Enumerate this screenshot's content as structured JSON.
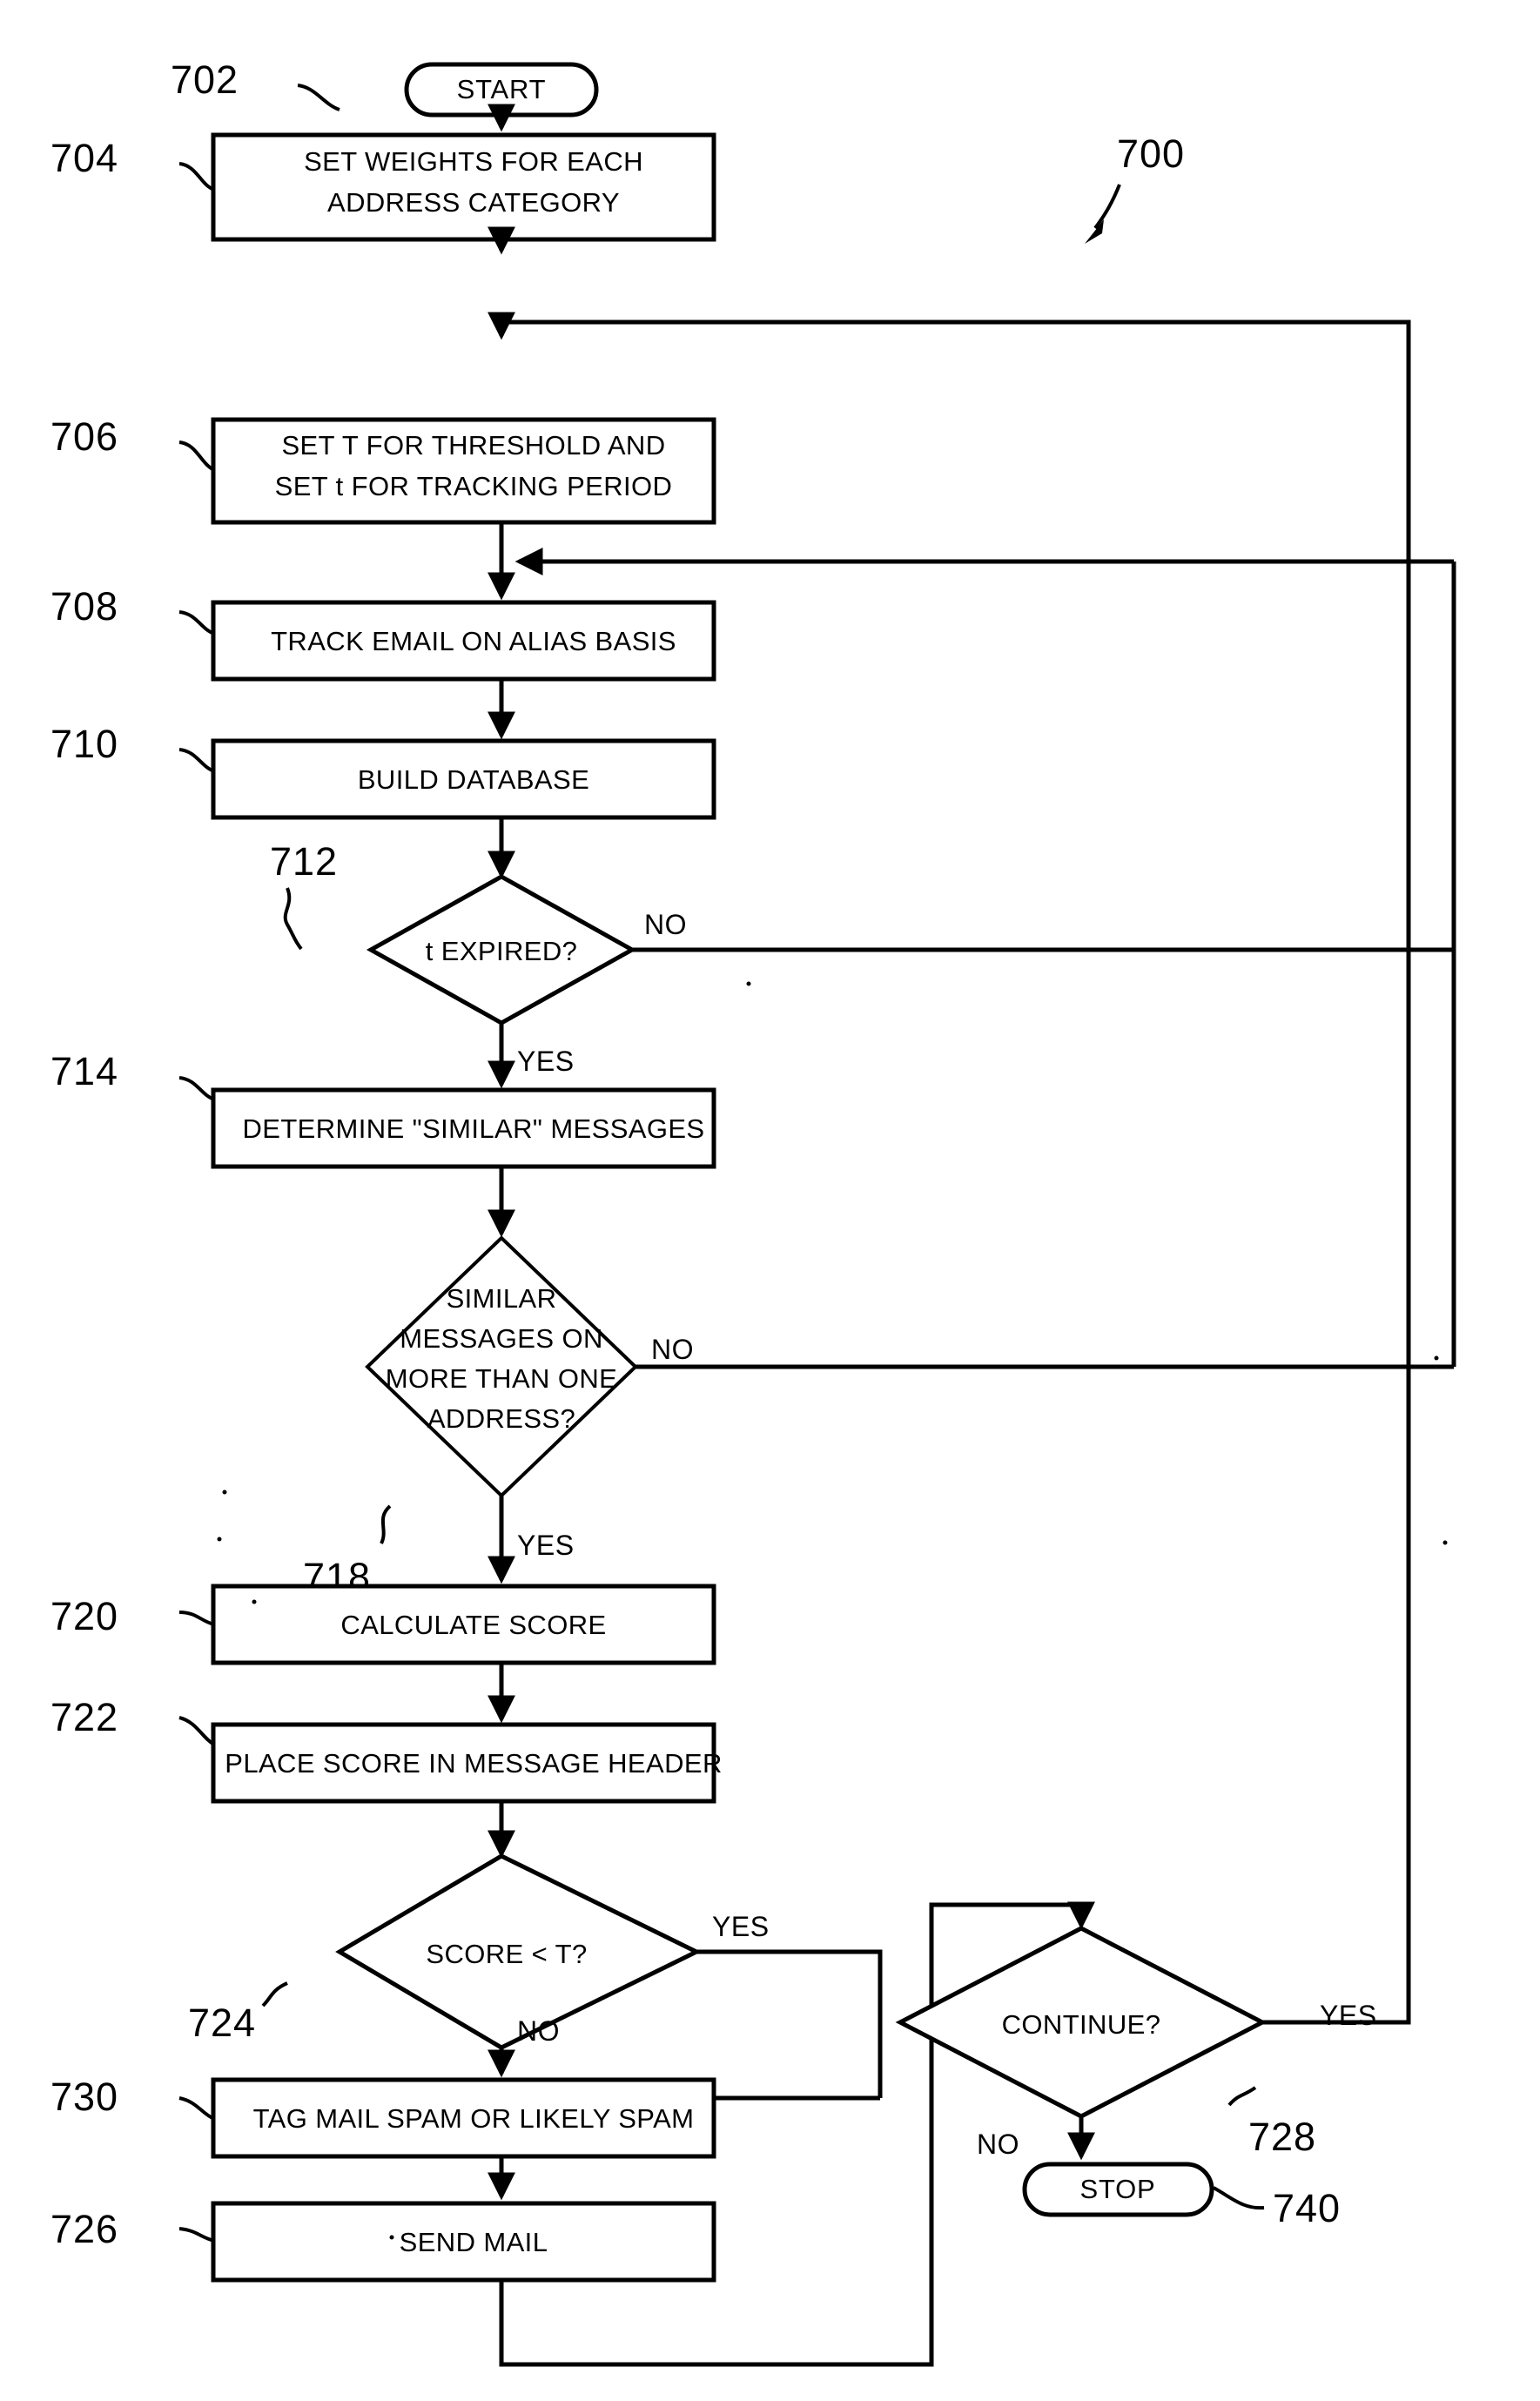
{
  "figure": {
    "figure_number": "700",
    "terminators": [
      {
        "ref": "702",
        "label": "START"
      },
      {
        "ref": "740",
        "label": "STOP"
      }
    ],
    "process_boxes": [
      {
        "ref": "704",
        "line1": "SET WEIGHTS FOR EACH",
        "line2": "ADDRESS CATEGORY"
      },
      {
        "ref": "706",
        "line1": "SET T FOR THRESHOLD AND",
        "line2": "SET t FOR TRACKING PERIOD"
      },
      {
        "ref": "708",
        "line1": "TRACK EMAIL ON ALIAS BASIS",
        "line2": ""
      },
      {
        "ref": "710",
        "line1": "BUILD DATABASE",
        "line2": ""
      },
      {
        "ref": "714",
        "line1": "DETERMINE \"SIMILAR\" MESSAGES",
        "line2": ""
      },
      {
        "ref": "720",
        "line1": "CALCULATE SCORE",
        "line2": ""
      },
      {
        "ref": "722",
        "line1": "PLACE SCORE IN MESSAGE HEADER",
        "line2": ""
      },
      {
        "ref": "730",
        "line1": "TAG MAIL SPAM OR LIKELY SPAM",
        "line2": ""
      },
      {
        "ref": "726",
        "line1": "SEND MAIL",
        "line2": ""
      }
    ],
    "decisions": [
      {
        "ref": "712",
        "line1": "t EXPIRED?",
        "line2": "",
        "line3": "",
        "line4": "",
        "yes_label": "YES",
        "no_label": "NO"
      },
      {
        "ref": "718",
        "line1": "SIMILAR",
        "line2": "MESSAGES ON",
        "line3": "MORE THAN ONE",
        "line4": "ADDRESS?",
        "yes_label": "YES",
        "no_label": "NO"
      },
      {
        "ref": "724",
        "line1": "SCORE < T?",
        "line2": "",
        "line3": "",
        "line4": "",
        "yes_label": "YES",
        "no_label": "NO"
      },
      {
        "ref": "728",
        "line1": "CONTINUE?",
        "line2": "",
        "line3": "",
        "line4": "",
        "yes_label": "YES",
        "no_label": "NO"
      }
    ],
    "colors": {
      "ink": "#000000",
      "paper": "#ffffff"
    }
  }
}
